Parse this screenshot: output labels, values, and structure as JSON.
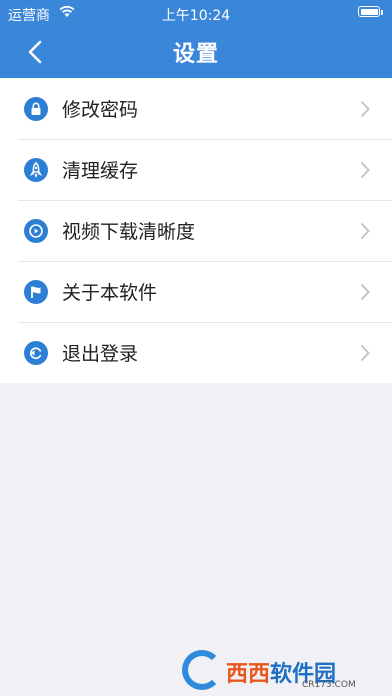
{
  "status_bar": {
    "carrier": "运营商",
    "time": "上午10:24"
  },
  "nav": {
    "title": "设置"
  },
  "menu": [
    {
      "label": "修改密码",
      "icon": "lock-icon"
    },
    {
      "label": "清理缓存",
      "icon": "rocket-icon"
    },
    {
      "label": "视频下载清晰度",
      "icon": "play-icon"
    },
    {
      "label": "关于本软件",
      "icon": "flag-icon"
    },
    {
      "label": "退出登录",
      "icon": "logout-icon"
    }
  ],
  "watermark": {
    "brand_red": "西西",
    "brand_blue": "软件园",
    "domain": "CR173.COM"
  },
  "colors": {
    "primary": "#3a86d8",
    "icon": "#2d7fd6",
    "background": "#f0f0f5"
  }
}
